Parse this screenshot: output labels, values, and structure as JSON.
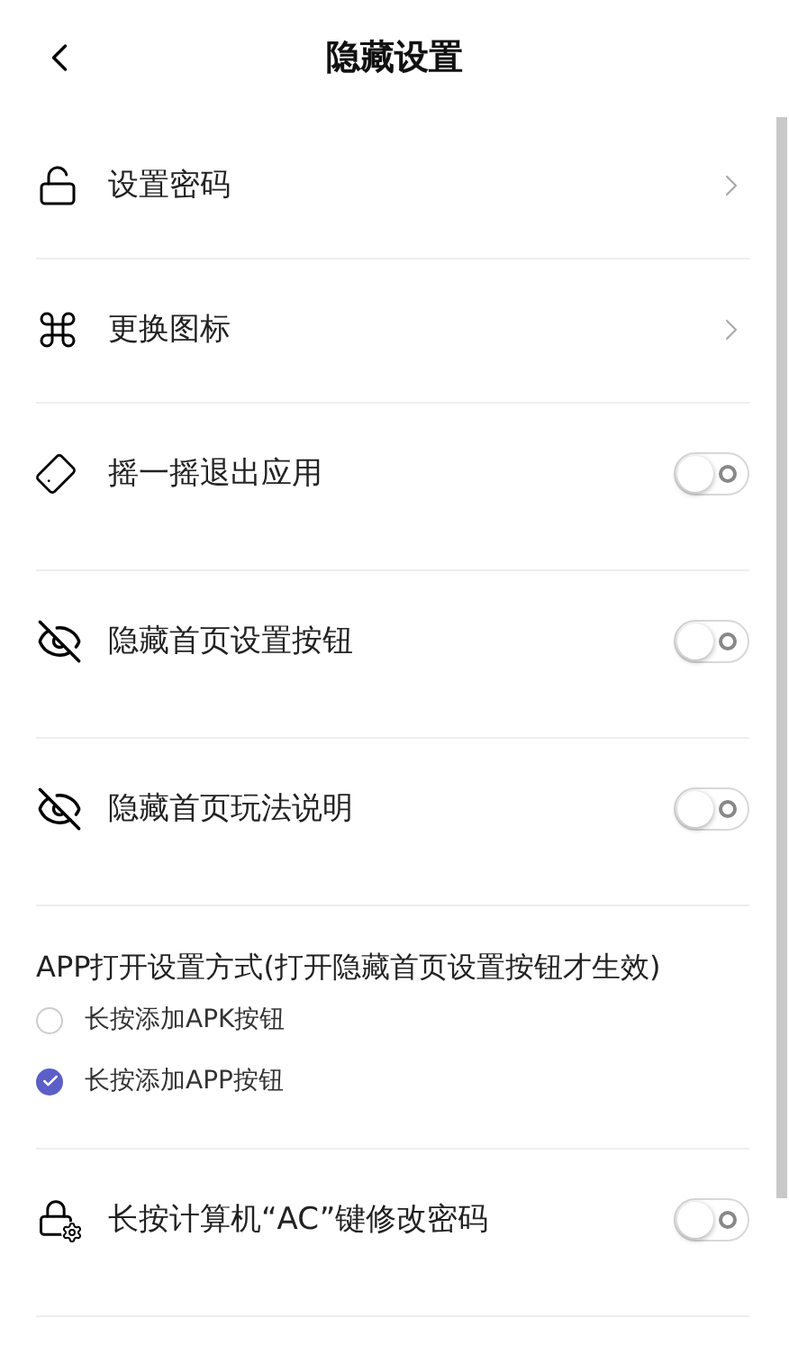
{
  "header": {
    "title": "隐藏设置"
  },
  "rows": [
    {
      "kind": "link",
      "label": "设置密码"
    },
    {
      "kind": "link",
      "label": "更换图标"
    },
    {
      "kind": "toggle",
      "label": "摇一摇退出应用",
      "on": false
    },
    {
      "kind": "toggle",
      "label": "隐藏首页设置按钮",
      "on": false
    },
    {
      "kind": "toggle",
      "label": "隐藏首页玩法说明",
      "on": false
    }
  ],
  "open_method": {
    "title": "APP打开设置方式(打开隐藏首页设置按钮才生效)",
    "options": [
      {
        "label": "长按添加APK按钮",
        "selected": false
      },
      {
        "label": "长按添加APP按钮",
        "selected": true
      }
    ]
  },
  "bottom_rows": [
    {
      "kind": "toggle",
      "label": "长按计算机“AC”键修改密码",
      "on": false
    }
  ]
}
